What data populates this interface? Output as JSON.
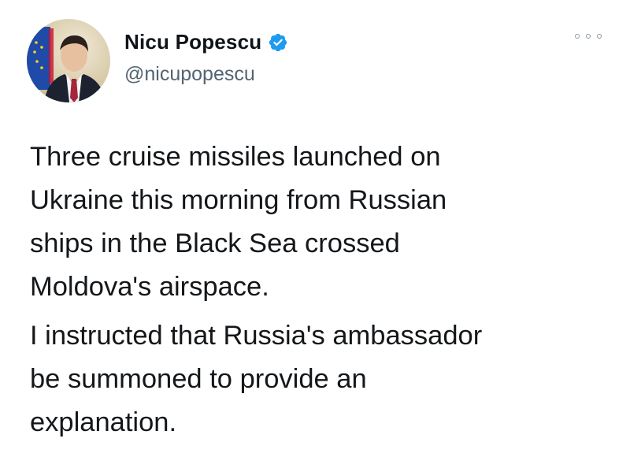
{
  "author": {
    "display_name": "Nicu Popescu",
    "handle": "@nicupopescu",
    "verified_icon": "verified-badge-icon",
    "avatar_icon": "profile-photo"
  },
  "menu": {
    "more_icon": "more-options-icon"
  },
  "tweet": {
    "paragraphs": [
      "Three cruise missiles launched on\nUkraine this morning from Russian\nships in the Black Sea crossed\nMoldova's airspace.",
      "I instructed that Russia's ambassador\nbe summoned to provide an\nexplanation."
    ]
  },
  "colors": {
    "verified": "#1d9bf0",
    "text_primary": "#0f1419",
    "text_secondary": "#536471"
  }
}
